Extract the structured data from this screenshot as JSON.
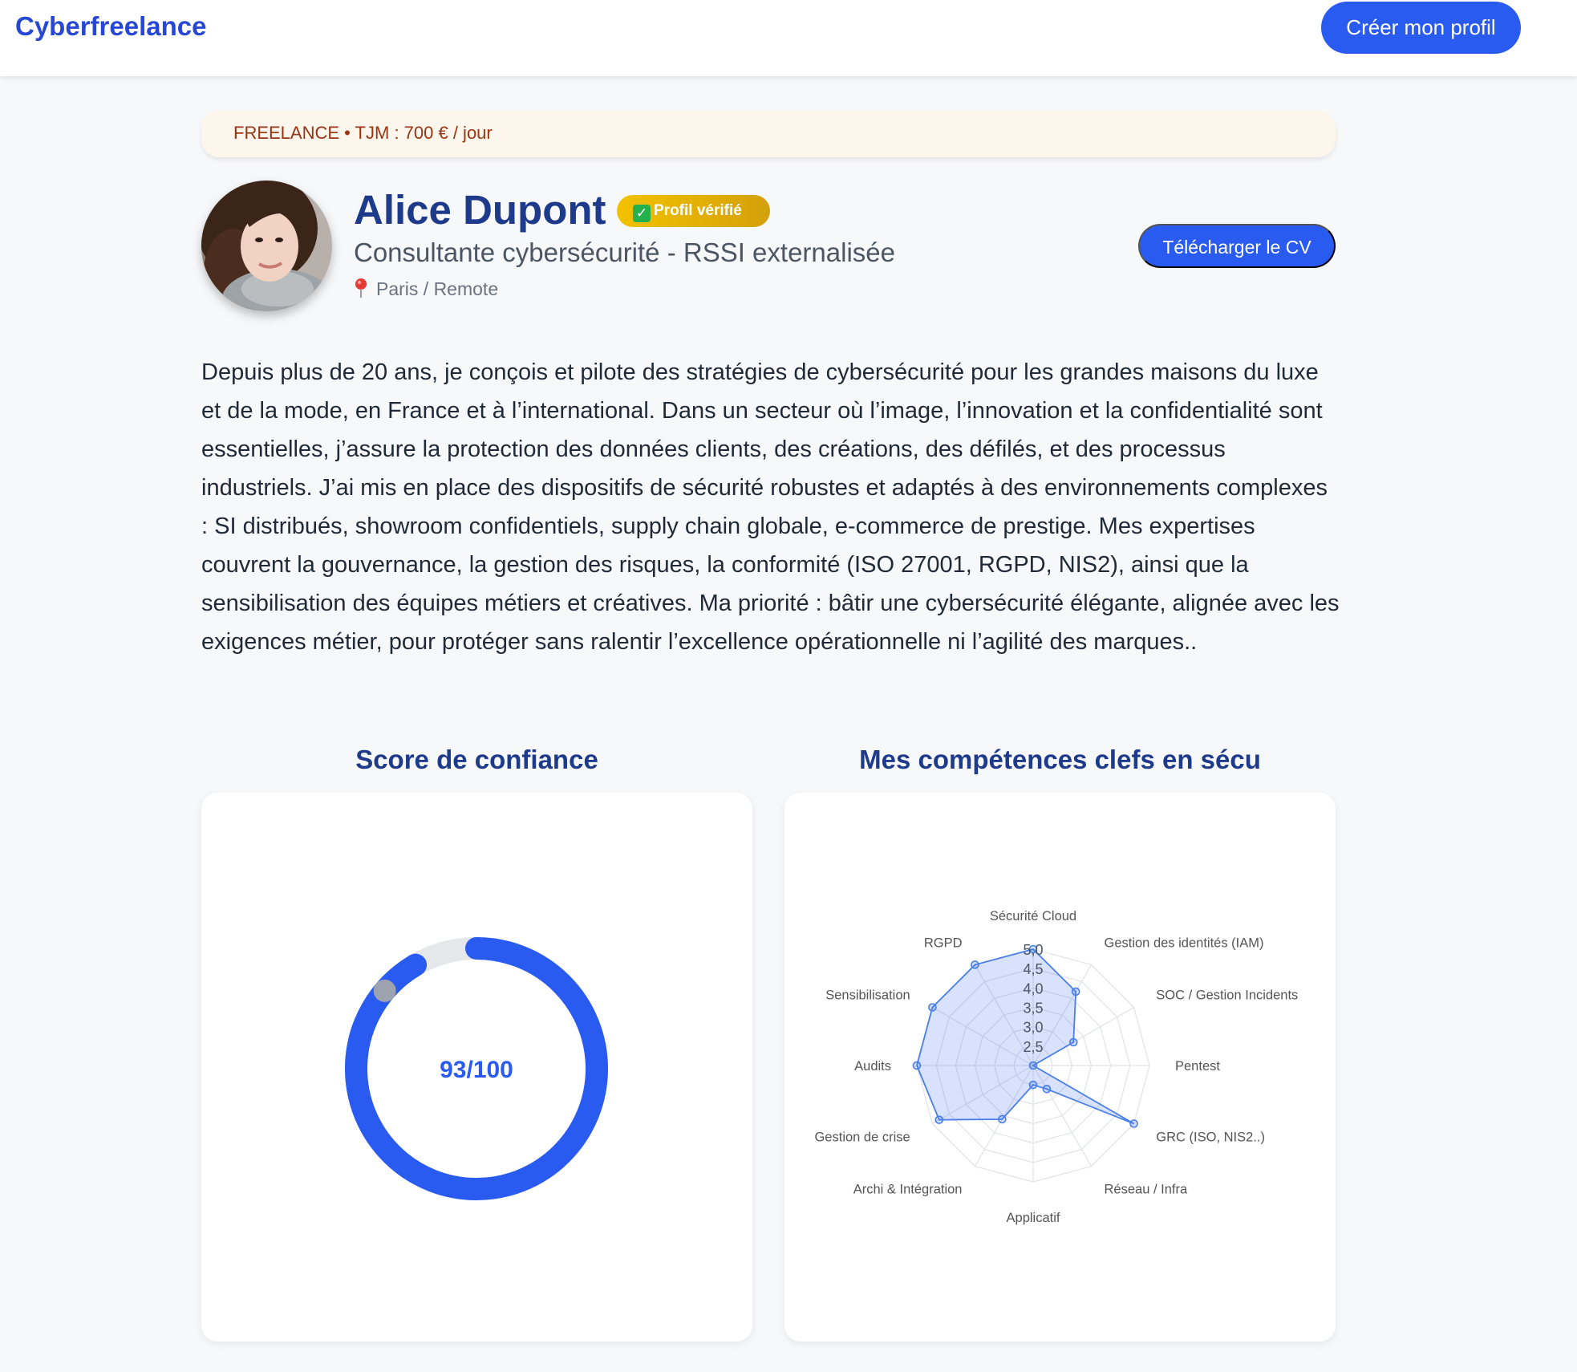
{
  "header": {
    "brand": "Cyberfreelance",
    "create_profile": "Créer mon profil"
  },
  "profile": {
    "banner": "FREELANCE • TJM : 700 € / jour",
    "name": "Alice Dupont",
    "verified_badge": "Profil vérifié",
    "headline": "Consultante cybersécurité - RSSI externalisée",
    "location": "Paris / Remote",
    "download_cv": "Télécharger le CV",
    "bio": "Depuis plus de 20 ans, je conçois et pilote des stratégies de cybersécurité pour les grandes maisons du luxe et de la mode, en France et à l’international. Dans un secteur où l’image, l’innovation et la confidentialité sont essentielles, j’assure la protection des données clients, des créations, des défilés, et des processus industriels. J’ai mis en place des dispositifs de sécurité robustes et adaptés à des environnements complexes : SI distribués, showroom confidentiels, supply chain globale, e-commerce de prestige. Mes expertises couvrent la gouvernance, la gestion des risques, la conformité (ISO 27001, RGPD, NIS2), ainsi que la sensibilisation des équipes métiers et créatives. Ma priorité : bâtir une cybersécurité élégante, alignée avec les exigences métier, pour protéger sans ralentir l’excellence opérationnelle ni l’agilité des marques.."
  },
  "sections": {
    "trust_title": "Score de confiance",
    "skills_title": "Mes compétences clefs en sécu"
  },
  "colors": {
    "accent": "#2a5bf0",
    "title": "#1e3a8a",
    "banner_bg": "#fdf6ec",
    "banner_text": "#9a3412",
    "badge": "#e6b400"
  },
  "chart_data": [
    {
      "type": "doughnut",
      "center_label": "93/100",
      "value": 93,
      "max": 100,
      "color": "#2a5bf0",
      "remainder_color": "#e5e7eb"
    },
    {
      "type": "radar",
      "categories": [
        "Sécurité Cloud",
        "Gestion des identités (IAM)",
        "SOC / Gestion Incidents",
        "Pentest",
        "GRC (ISO, NIS2..)",
        "Réseau / Infra",
        "Applicatif",
        "Archi & Intégration",
        "Gestion  de crise",
        "Audits",
        "Sensibilisation",
        "RGPD"
      ],
      "series": [
        {
          "values": [
            5.0,
            4.2,
            3.2,
            2.0,
            5.0,
            2.7,
            2.5,
            3.6,
            4.8,
            5.0,
            5.0,
            5.0
          ]
        }
      ],
      "ticks": [
        "2,5",
        "3,0",
        "3,5",
        "4,0",
        "4,5",
        "5,0"
      ],
      "rmin": 2.0,
      "rmax": 5.0,
      "grid": true,
      "fill_color": "rgba(59,110,240,0.20)",
      "line_color": "#4a7ee8"
    }
  ]
}
